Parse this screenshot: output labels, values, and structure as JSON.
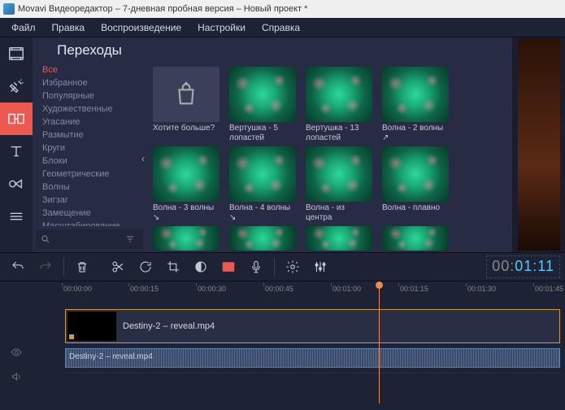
{
  "window": {
    "title": "Movavi Видеоредактор – 7-дневная пробная версия – Новый проект *"
  },
  "menu": {
    "items": [
      "Файл",
      "Правка",
      "Воспроизведение",
      "Настройки",
      "Справка"
    ]
  },
  "panel": {
    "title": "Переходы",
    "categories": [
      "Все",
      "Избранное",
      "Популярные",
      "Художественные",
      "Угасание",
      "Размытие",
      "Круги",
      "Блоки",
      "Геометрические",
      "Волны",
      "Зигзаг",
      "Замещение",
      "Масштабирование"
    ],
    "selected_category": 0,
    "more_label": "Хотите больше?",
    "transitions_row1": [
      "Вертушка - 5 лопастей",
      "Вертушка - 13 лопастей",
      "Волна - 2 волны ↗"
    ],
    "transitions_row2": [
      "Волна - 3 волны ↘",
      "Волна - 4 волны ↘",
      "Волна - из центра",
      "Волна - плавно"
    ]
  },
  "toolbar": {},
  "ruler": {
    "ticks": [
      "00:00:00",
      "00:00:15",
      "00:00:30",
      "00:00:45",
      "00:01:00",
      "00:01:15",
      "00:01:30",
      "00:01:45"
    ]
  },
  "timecode": {
    "prefix": "00:",
    "value": "01:11"
  },
  "timeline": {
    "video_clip": "Destiny-2 – reveal.mp4",
    "audio_clip": "Destiny-2 – reveal.mp4"
  }
}
